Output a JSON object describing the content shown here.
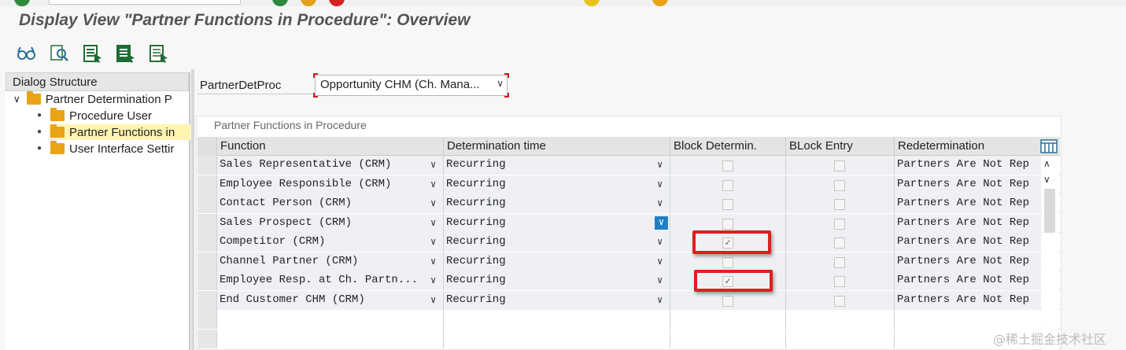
{
  "colors": {
    "accent_red": "#e01e1e",
    "folder": "#e8a317",
    "blue_dropdown": "#1f7fc6"
  },
  "window": {
    "title": "Display View \"Partner Functions in Procedure\": Overview"
  },
  "toolbar": {
    "buttons": [
      {
        "icon": "display-glasses-icon"
      },
      {
        "icon": "find-icon"
      },
      {
        "icon": "select-all-icon"
      },
      {
        "icon": "select-block-icon"
      },
      {
        "icon": "deselect-all-icon"
      }
    ]
  },
  "dialog_structure": {
    "title": "Dialog Structure",
    "items": [
      {
        "label": "Partner Determination P",
        "level": 0
      },
      {
        "label": "Procedure User",
        "level": 1
      },
      {
        "label": "Partner Functions in",
        "level": 1,
        "selected": true
      },
      {
        "label": "User Interface Settir",
        "level": 1
      }
    ]
  },
  "header_field": {
    "label": "PartnerDetProc",
    "value": "Opportunity CHM (Ch. Mana..."
  },
  "table": {
    "title": "Partner Functions in Procedure",
    "columns": [
      "Function",
      "Determination time",
      "Block Determin.",
      "BLock Entry",
      "Redetermination"
    ],
    "rows": [
      {
        "function": "Sales Representative (CRM)",
        "time": "Recurring",
        "block_det": false,
        "block_entry": false,
        "redet": "Partners Are Not Rep"
      },
      {
        "function": "Employee Responsible (CRM)",
        "time": "Recurring",
        "block_det": false,
        "block_entry": false,
        "redet": "Partners Are Not Rep"
      },
      {
        "function": "Contact Person (CRM)",
        "time": "Recurring",
        "block_det": false,
        "block_entry": false,
        "redet": "Partners Are Not Rep"
      },
      {
        "function": "Sales Prospect (CRM)",
        "time": "Recurring",
        "block_det": false,
        "block_entry": false,
        "redet": "Partners Are Not Rep"
      },
      {
        "function": "Competitor (CRM)",
        "time": "Recurring",
        "block_det": true,
        "block_entry": false,
        "redet": "Partners Are Not Rep"
      },
      {
        "function": "Channel Partner (CRM)",
        "time": "Recurring",
        "block_det": false,
        "block_entry": false,
        "redet": "Partners Are Not Rep"
      },
      {
        "function": "Employee Resp. at Ch. Partn...",
        "time": "Recurring",
        "block_det": true,
        "block_entry": false,
        "redet": "Partners Are Not Rep"
      },
      {
        "function": "End Customer CHM (CRM)",
        "time": "Recurring",
        "block_det": false,
        "block_entry": false,
        "redet": "Partners Are Not Rep"
      }
    ],
    "empty_rows": 2
  },
  "watermark": "@稀土掘金技术社区"
}
